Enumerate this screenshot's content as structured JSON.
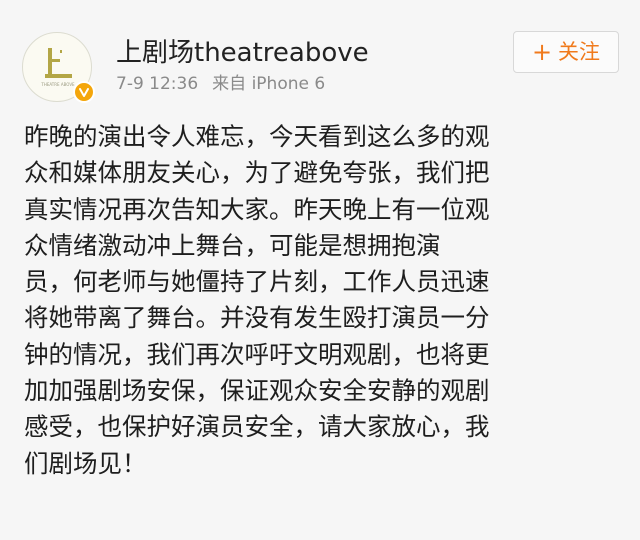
{
  "post": {
    "author": "上剧场theatreabove",
    "date": "7-9 12:36",
    "source": "来自 iPhone 6",
    "follow_label": "关注",
    "follow_plus": "+",
    "avatar_logo_text": "THEATRE ABOVE",
    "lines": [
      "昨晚的演出令人难忘，今天看到这么多的观",
      "众和媒体朋友关心，为了避免夸张，我们把",
      "真实情况再次告知大家。昨天晚上有一位观",
      "众情绪激动冲上舞台，可能是想拥抱演",
      "员，何老师与她僵持了片刻，工作人员迅速",
      "将她带离了舞台。并没有发生殴打演员一分",
      "钟的情况，我们再次呼吁文明观剧，也将更",
      "加加强剧场安保，保证观众安全安静的观剧",
      "感受，也保护好演员安全，请大家放心，我",
      "们剧场见！"
    ]
  },
  "colors": {
    "accent": "#f07a1c",
    "verified": "#f4a60b",
    "meta_text": "#8a8a8a",
    "logo": "#b3a646"
  },
  "icons": {
    "avatar": "theatre-logo",
    "badge": "verified-v-icon"
  }
}
